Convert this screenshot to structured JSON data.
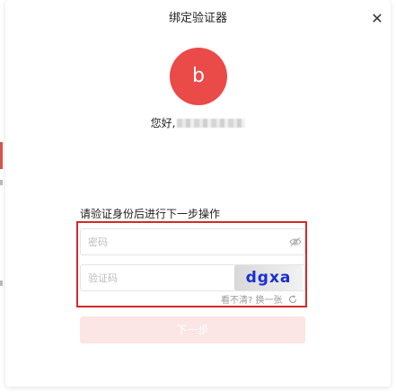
{
  "dialog": {
    "title": "绑定验证器",
    "close_label": "✕"
  },
  "user": {
    "avatar_letter": "b",
    "greeting": "您好,"
  },
  "form": {
    "instruction": "请验证身份后进行下一步操作",
    "password_placeholder": "密码",
    "captcha_placeholder": "验证码",
    "captcha_code": "dgxa",
    "refresh_prefix": "看不清?",
    "refresh_link": "换一张",
    "next_button": "下一步"
  },
  "colors": {
    "avatar": "#ea4a48",
    "highlight_border": "#d42a2a",
    "captcha_text": "#1a2fd0",
    "next_button_disabled": "#fbe5e5"
  },
  "icons": [
    "close-icon",
    "eye-icon",
    "refresh-icon"
  ]
}
